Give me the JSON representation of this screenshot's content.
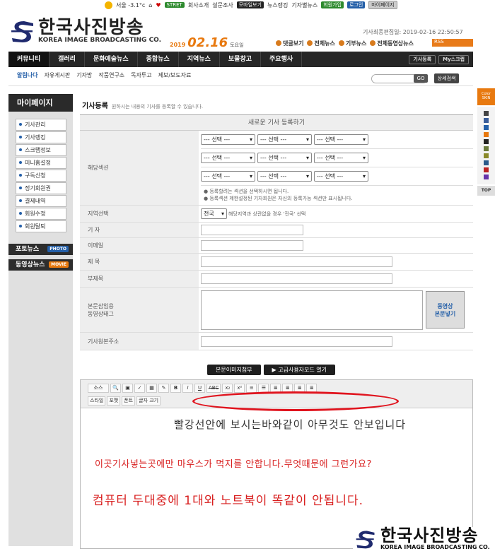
{
  "util": {
    "weather": "서울 -3.1°c",
    "street": "STRET",
    "about": "회사소개",
    "survey": "설문조사",
    "mobile": "모바일보기",
    "news_rank": "뉴스랭킹",
    "reporter_news": "기자별뉴스",
    "join": "회원가입",
    "login": "로그인",
    "mypage": "마이페이지"
  },
  "logo": {
    "ko": "한국사진방송",
    "en": "KOREA IMAGE BROADCASTING CO."
  },
  "date": {
    "year": "2019",
    "md": "02.16",
    "dow": "토요일"
  },
  "updated": "기사최종편집일: 2019-02-16 22:50:57",
  "quick": [
    "댓글보기",
    "전체뉴스",
    "기부뉴스",
    "전체동영상뉴스"
  ],
  "rss": "RSS",
  "nav": {
    "items": [
      "커뮤니티",
      "갤러리",
      "문화예술뉴스",
      "종합뉴스",
      "지역뉴스",
      "보물창고",
      "주요행사"
    ],
    "right": [
      "기사등록",
      "My스크랩"
    ]
  },
  "subnav": [
    "알림나다",
    "자유게시판",
    "기자방",
    "작품연구소",
    "독자투고",
    "제보/보도자료"
  ],
  "search": {
    "go": "GO",
    "adv": "상세검색"
  },
  "sidebar": {
    "title": "마이페이지",
    "items": [
      "기사관리",
      "기사랭킹",
      "스크랩정보",
      "미니홈설정",
      "구독신청",
      "정기회원권",
      "결제내역",
      "회원수정",
      "회원탈퇴"
    ],
    "photo": "포토뉴스",
    "photo_badge": "PHOTO",
    "video": "동영상뉴스",
    "video_badge": "MOVIE"
  },
  "rail": {
    "color": "Color SKIN",
    "top": "TOP"
  },
  "content": {
    "title": "기사등록",
    "desc": "원하시는 내용의 기사를 등록할 수 있습니다."
  },
  "form": {
    "header": "새로운 기사 등록하기",
    "section_label": "해당섹션",
    "select_placeholder": "--- 선택 ---",
    "notes": [
      "● 등록할려는 섹션을 선택하시면 됩니다.",
      "● 등록섹션 제한설정된 기자회원은 자신의 등록가능 섹션만 표시됩니다."
    ],
    "region_label": "지역선택",
    "region_value": "전국",
    "region_note": "해당지역과 상관없을 경우 '전국' 선택",
    "reporter": "기 자",
    "email": "이메일",
    "subject": "제 목",
    "subtitle": "부제목",
    "insert_label_1": "본문삽입용",
    "insert_label_2": "동영상태그",
    "video_btn_1": "동영상",
    "video_btn_2": "본문넣기",
    "source": "기사원본주소"
  },
  "tool_btns": [
    "본문이미지첨부",
    "고급사용자모드 열기"
  ],
  "toolbar": {
    "source": "소스",
    "row1": [
      "B",
      "I",
      "U",
      "ABC",
      "x₂",
      "x²"
    ],
    "row2": [
      "스타일",
      "포맷",
      "폰트",
      "글자 크기"
    ]
  },
  "overlay": {
    "line1": "빨강선안에 보시는바와같이 아무것도 안보입니다",
    "line2": "이곳기사넣는곳에만 마우스가 먹지를 안합니다.무엇때문에 그런가요?",
    "line3": "컴퓨터 두대중에 1대와 노트북이 똑같이 안됩니다."
  },
  "watermark": {
    "ko": "한국사진방송",
    "en": "KOREA IMAGE BROADCASTING CO."
  },
  "colors": {
    "accent": "#e8790f",
    "nav": "#262626",
    "brand_blue": "#245fa8",
    "annotation_red": "#e0141e"
  }
}
